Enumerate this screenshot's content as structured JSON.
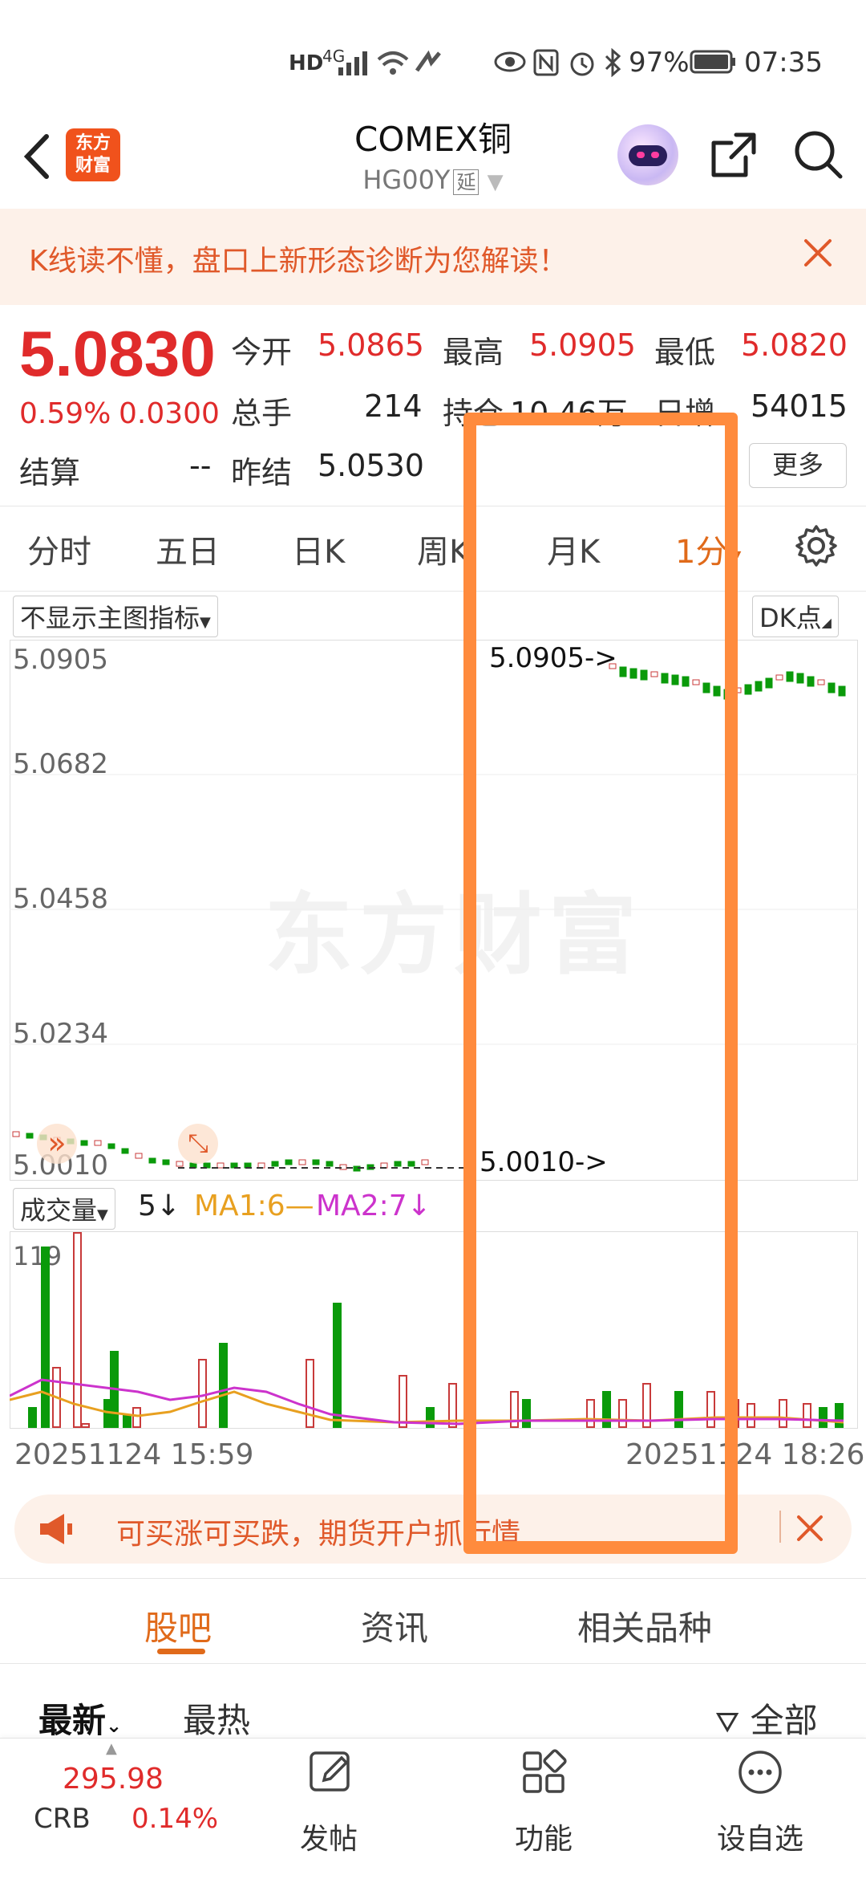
{
  "status_bar": {
    "network": "4G",
    "battery": "97%",
    "time": "07:35"
  },
  "header": {
    "title": "COMEX铜",
    "code": "HG00Y",
    "delay_badge": "延"
  },
  "banner": {
    "text": "K线读不懂，盘口上新形态诊断为您解读！"
  },
  "quote": {
    "price": "5.0830",
    "change_pct": "0.59%",
    "change_val": "0.0300",
    "open_label": "今开",
    "open": "5.0865",
    "high_label": "最高",
    "high": "5.0905",
    "low_label": "最低",
    "low": "5.0820",
    "volume_label": "总手",
    "volume": "214",
    "oi_label": "持仓",
    "oi": "10.46万",
    "daily_inc_label": "日增",
    "daily_inc": "54015",
    "settle_label": "结算",
    "settle": "--",
    "prev_settle_label": "昨结",
    "prev_settle": "5.0530",
    "more": "更多"
  },
  "period_tabs": [
    "分时",
    "五日",
    "日K",
    "周K",
    "月K",
    "1分"
  ],
  "chart": {
    "indicator_select": "不显示主图指标",
    "dk_select": "DK点",
    "y_labels": [
      "5.0905",
      "5.0682",
      "5.0458",
      "5.0234",
      "5.0010"
    ],
    "high_marker": "5.0905->",
    "low_marker": "5.0010->",
    "watermark": "东方财富",
    "volume_select": "成交量",
    "volume_period": "5",
    "ma1": "MA1:6",
    "ma2": "MA2:7",
    "vol_max": "119",
    "x_start": "20251124 15:59",
    "x_end": "20251124 18:26",
    "colors": {
      "up": "#c83a3a",
      "down": "#0a9a0a",
      "ma1": "#e8a020",
      "ma2": "#cc33cc"
    }
  },
  "promo": {
    "text": "可买涨可买跌，期货开户抓行情"
  },
  "sub_tabs": [
    "股吧",
    "资讯",
    "相关品种"
  ],
  "sort": {
    "latest": "最新",
    "hot": "最热",
    "filter": "全部"
  },
  "bottom_nav": {
    "index_value": "295.98",
    "index_name": "CRB",
    "index_change": "0.14%",
    "post": "发帖",
    "func": "功能",
    "watch": "设自选"
  }
}
